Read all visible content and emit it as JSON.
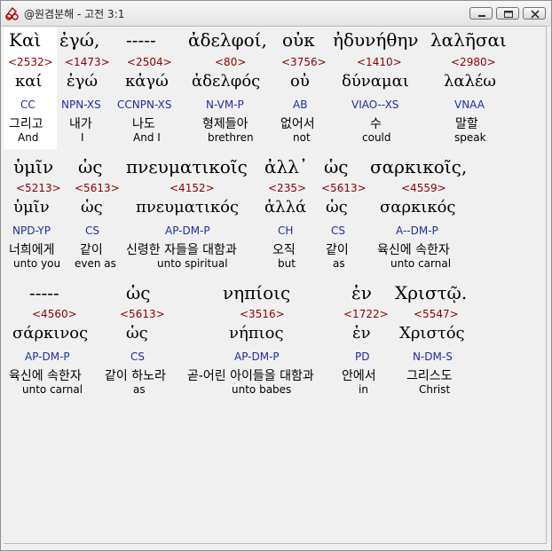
{
  "window": {
    "title": "@원겸분해 - 고전 3:1",
    "buttons": [
      "minimize",
      "maximize",
      "close"
    ]
  },
  "colors": {
    "strong_number": "#8b0000",
    "parsing": "#1f2f9f",
    "text": "#000000"
  },
  "rows": [
    {
      "words": [
        {
          "greek": "Καὶ",
          "num": "<2532>",
          "lemma": "καί",
          "parse": "CC",
          "korean": "그리고",
          "english": "And"
        },
        {
          "greek": "ἐγώ,",
          "num": "<1473>",
          "lemma": "ἐγώ",
          "parse": "NPN-XS",
          "korean": "내가",
          "english": "I"
        },
        {
          "greek": "-----",
          "num": "<2504>",
          "lemma": "κἀγώ",
          "parse": "CCNPN-XS",
          "korean": "나도",
          "english": "And I"
        },
        {
          "greek": "ἀδελφοί,",
          "num": "<80>",
          "lemma": "ἀδελφός",
          "parse": "N-VM-P",
          "korean": "형제들아",
          "english": "brethren"
        },
        {
          "greek": "οὐκ",
          "num": "<3756>",
          "lemma": "οὐ",
          "parse": "AB",
          "korean": "없어서",
          "english": "not"
        },
        {
          "greek": "ἠδυνήθην",
          "num": "<1410>",
          "lemma": "δύναμαι",
          "parse": "VIAO--XS",
          "korean": "수",
          "english": "could"
        },
        {
          "greek": "λαλῆσαι",
          "num": "<2980>",
          "lemma": "λαλέω",
          "parse": "VNAA",
          "korean": "말할",
          "english": "speak"
        }
      ]
    },
    {
      "words": [
        {
          "greek": "ὑμῖν",
          "num": "<5213>",
          "lemma": "ὑμῖν",
          "parse": "NPD-YP",
          "korean": "너희에게",
          "english": "unto you"
        },
        {
          "greek": "ὡς",
          "num": "<5613>",
          "lemma": "ὡς",
          "parse": "CS",
          "korean": "같이",
          "english": "even as"
        },
        {
          "greek": "πνευματικοῖς",
          "num": "<4152>",
          "lemma": "πνευματικός",
          "parse": "AP-DM-P",
          "korean": "신령한 자들을 대함과",
          "english": "unto spiritual"
        },
        {
          "greek": "ἀλλ᾽",
          "num": "<235>",
          "lemma": "ἀλλά",
          "parse": "CH",
          "korean": "오직",
          "english": "but"
        },
        {
          "greek": "ὡς",
          "num": "<5613>",
          "lemma": "ὡς",
          "parse": "CS",
          "korean": "같이",
          "english": "as"
        },
        {
          "greek": "σαρκικοῖς,",
          "num": "<4559>",
          "lemma": "σαρκικός",
          "parse": "A--DM-P",
          "korean": "육신에 속한자",
          "english": "unto carnal"
        }
      ]
    },
    {
      "words": [
        {
          "greek": "-----",
          "num": "<4560>",
          "lemma": "σάρκινος",
          "parse": "AP-DM-P",
          "korean": "육신에 속한자",
          "english": "unto carnal"
        },
        {
          "greek": "ὡς",
          "num": "<5613>",
          "lemma": "ὡς",
          "parse": "CS",
          "korean": "같이 하노라",
          "english": "as"
        },
        {
          "greek": "νηπίοις",
          "num": "<3516>",
          "lemma": "νήπιος",
          "parse": "AP-DM-P",
          "korean": "곧-어린 아이들을 대함과",
          "english": "unto babes"
        },
        {
          "greek": "ἐν",
          "num": "<1722>",
          "lemma": "ἐν",
          "parse": "PD",
          "korean": "안에서",
          "english": "in"
        },
        {
          "greek": "Χριστῷ.",
          "num": "<5547>",
          "lemma": "Χριστός",
          "parse": "N-DM-S",
          "korean": "그리스도",
          "english": "Christ"
        }
      ]
    }
  ]
}
